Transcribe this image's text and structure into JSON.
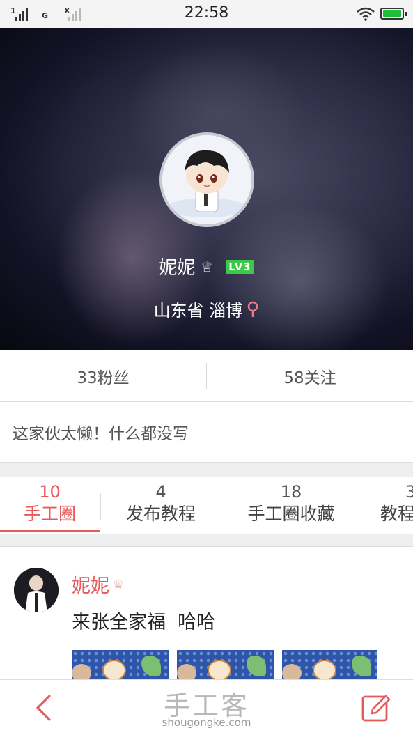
{
  "status_bar": {
    "signal1_label": "1",
    "signal2_label": "G",
    "signal3_label": "X",
    "time": "22:58"
  },
  "profile": {
    "name": "妮妮",
    "crown_icon": "crown-icon",
    "level_badge": "LV3",
    "location": "山东省 淄博",
    "location_icon": "map-pin-icon",
    "accent_color": "#e85a5a",
    "level_color": "#3ec84a"
  },
  "stats": {
    "fans": "33粉丝",
    "following": "58关注"
  },
  "bio": "这家伙太懒！什么都没写",
  "tabs": [
    {
      "count": "10",
      "label": "手工圈",
      "active": true
    },
    {
      "count": "4",
      "label": "发布教程",
      "active": false
    },
    {
      "count": "18",
      "label": "手工圈收藏",
      "active": false
    },
    {
      "count": "3",
      "label": "教程",
      "active": false
    }
  ],
  "post": {
    "author": "妮妮",
    "text": "来张全家福  哈哈"
  },
  "bottom_bar": {
    "back_icon": "chevron-left-icon",
    "edit_icon": "edit-icon",
    "watermark": "手工客",
    "watermark_url": "shougongke.com"
  }
}
